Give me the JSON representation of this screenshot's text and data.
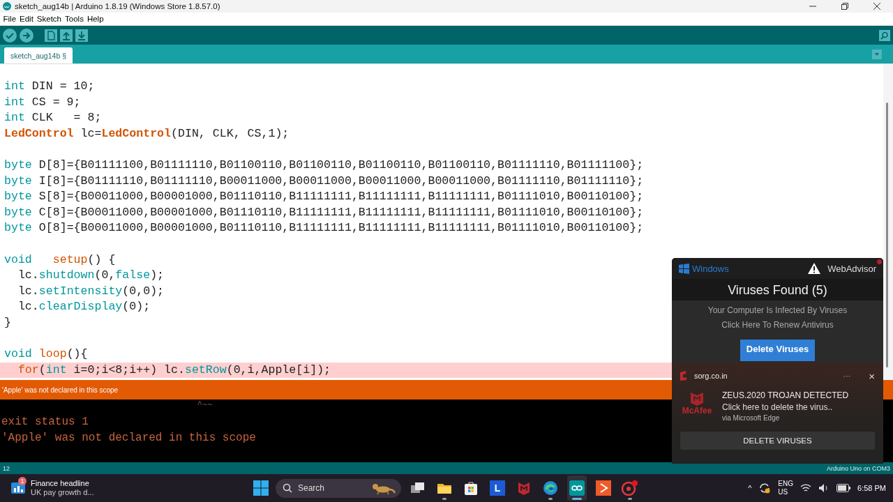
{
  "window": {
    "title": "sketch_aug14b | Arduino 1.8.19 (Windows Store 1.8.57.0)"
  },
  "menu": [
    "File",
    "Edit",
    "Sketch",
    "Tools",
    "Help"
  ],
  "toolbar": {
    "buttons": [
      {
        "kind": "verify"
      },
      {
        "kind": "upload"
      },
      {
        "kind": "new"
      },
      {
        "kind": "open"
      },
      {
        "kind": "save"
      }
    ],
    "right": {
      "kind": "serial"
    }
  },
  "tabs": [
    {
      "label": "sketch_aug14b §",
      "selected": true
    }
  ],
  "editor": {
    "lines": [
      {
        "kind": "code",
        "highlighted": false,
        "tokens": [
          {
            "text": "int",
            "kind": "type"
          },
          {
            "text": " DIN = 10;",
            "kind": "plain"
          }
        ]
      },
      {
        "kind": "code",
        "highlighted": false,
        "tokens": [
          {
            "text": "int",
            "kind": "type"
          },
          {
            "text": " CS = 9;",
            "kind": "plain"
          }
        ]
      },
      {
        "kind": "code",
        "highlighted": false,
        "tokens": [
          {
            "text": "int",
            "kind": "type"
          },
          {
            "text": " CLK   = 8;",
            "kind": "plain"
          }
        ]
      },
      {
        "kind": "code",
        "highlighted": false,
        "tokens": [
          {
            "text": "LedControl",
            "kind": "class"
          },
          {
            "text": " lc=",
            "kind": "plain"
          },
          {
            "text": "LedControl",
            "kind": "class"
          },
          {
            "text": "(DIN, CLK, CS,1);",
            "kind": "plain"
          }
        ]
      },
      {
        "kind": "blank"
      },
      {
        "kind": "code",
        "highlighted": false,
        "tokens": [
          {
            "text": "byte",
            "kind": "type"
          },
          {
            "text": " D[8]={B01111100,B01111110,B01100110,B01100110,B01100110,B01100110,B01111110,B01111100};",
            "kind": "plain"
          }
        ]
      },
      {
        "kind": "code",
        "highlighted": false,
        "tokens": [
          {
            "text": "byte",
            "kind": "type"
          },
          {
            "text": " I[8]={B01111110,B01111110,B00011000,B00011000,B00011000,B00011000,B01111110,B01111110};",
            "kind": "plain"
          }
        ]
      },
      {
        "kind": "code",
        "highlighted": false,
        "tokens": [
          {
            "text": "byte",
            "kind": "type"
          },
          {
            "text": " S[8]={B00011000,B00001000,B01110110,B11111111,B11111111,B11111111,B01111010,B00110100};",
            "kind": "plain"
          }
        ]
      },
      {
        "kind": "code",
        "highlighted": false,
        "tokens": [
          {
            "text": "byte",
            "kind": "type"
          },
          {
            "text": " C[8]={B00011000,B00001000,B01110110,B11111111,B11111111,B11111111,B01111010,B00110100};",
            "kind": "plain"
          }
        ]
      },
      {
        "kind": "code",
        "highlighted": false,
        "tokens": [
          {
            "text": "byte",
            "kind": "type"
          },
          {
            "text": " O[8]={B00011000,B00001000,B01110110,B11111111,B11111111,B11111111,B01111010,B00110100};",
            "kind": "plain"
          }
        ]
      },
      {
        "kind": "blank"
      },
      {
        "kind": "code",
        "highlighted": false,
        "tokens": [
          {
            "text": "void",
            "kind": "type"
          },
          {
            "text": "   setup",
            "kind": "func"
          },
          {
            "text": "() {",
            "kind": "plain"
          }
        ]
      },
      {
        "kind": "code",
        "highlighted": false,
        "tokens": [
          {
            "text": "  lc.",
            "kind": "plain"
          },
          {
            "text": "shutdown",
            "kind": "method"
          },
          {
            "text": "(0,",
            "kind": "plain"
          },
          {
            "text": "false",
            "kind": "literal"
          },
          {
            "text": ");",
            "kind": "plain"
          }
        ]
      },
      {
        "kind": "code",
        "highlighted": false,
        "tokens": [
          {
            "text": "  lc.",
            "kind": "plain"
          },
          {
            "text": "setIntensity",
            "kind": "method"
          },
          {
            "text": "(0,0);",
            "kind": "plain"
          }
        ]
      },
      {
        "kind": "code",
        "highlighted": false,
        "tokens": [
          {
            "text": "  lc.",
            "kind": "plain"
          },
          {
            "text": "clearDisplay",
            "kind": "method"
          },
          {
            "text": "(0);",
            "kind": "plain"
          }
        ]
      },
      {
        "kind": "code",
        "highlighted": false,
        "tokens": [
          {
            "text": "}",
            "kind": "plain"
          }
        ]
      },
      {
        "kind": "blank"
      },
      {
        "kind": "code",
        "highlighted": false,
        "tokens": [
          {
            "text": "void",
            "kind": "type"
          },
          {
            "text": " loop",
            "kind": "func"
          },
          {
            "text": "(){",
            "kind": "plain"
          }
        ]
      },
      {
        "kind": "code",
        "highlighted": true,
        "tokens": [
          {
            "text": "  for",
            "kind": "func"
          },
          {
            "text": "(",
            "kind": "plain"
          },
          {
            "text": "int",
            "kind": "type"
          },
          {
            "text": " i=0;i<8;i++) lc.",
            "kind": "plain"
          },
          {
            "text": "setRow",
            "kind": "method"
          },
          {
            "text": "(0,i,Apple[i]);",
            "kind": "plain"
          }
        ]
      }
    ]
  },
  "error_bar": {
    "message": "'Apple' was not declared in this scope"
  },
  "console": {
    "lines": [
      {
        "text": "                                       ^~~",
        "kind": "faint"
      },
      {
        "text": "exit status 1",
        "kind": "error"
      },
      {
        "text": "'Apple' was not declared in this scope",
        "kind": "error"
      }
    ]
  },
  "status_bar": {
    "line": "12",
    "board": "Arduino Uno on COM3"
  },
  "advisor_popup": {
    "brand": "Windows",
    "source": "WebAdvisor",
    "title": "Viruses Found (5)",
    "lines": [
      "Your Computer Is Infected By Viruses",
      "Click Here To Renew Antivirus"
    ],
    "button": "Delete Viruses"
  },
  "toast": {
    "site": "sorg.co.in",
    "more": "···",
    "close": "×",
    "logo_text": "McAfee",
    "title": "ZEUS.2020 TROJAN DETECTED",
    "body": "Click here to delete the virus..",
    "via": "via Microsoft Edge",
    "button": "DELETE VIRUSES"
  },
  "taskbar": {
    "widget": {
      "badge": "1",
      "title": "Finance headline",
      "subtitle": "UK pay growth d..."
    },
    "search": {
      "placeholder": "Search"
    },
    "apps": [
      {
        "kind": "taskview",
        "open": false,
        "active": false
      },
      {
        "kind": "explorer",
        "open": true,
        "active": false
      },
      {
        "kind": "store",
        "open": false,
        "active": false
      },
      {
        "kind": "letter",
        "label": "L",
        "open": false,
        "active": false
      },
      {
        "kind": "mcafee",
        "open": false,
        "active": false
      },
      {
        "kind": "edge",
        "open": true,
        "active": false
      },
      {
        "kind": "arduino",
        "open": true,
        "active": true
      },
      {
        "kind": "slides",
        "open": false,
        "active": false
      },
      {
        "kind": "record",
        "open": true,
        "active": false
      }
    ],
    "tray": {
      "chevron": "^",
      "lang": "ENG",
      "region": "US",
      "time": "6:58 PM"
    }
  }
}
